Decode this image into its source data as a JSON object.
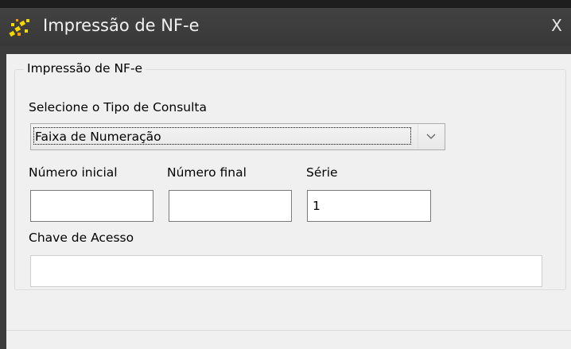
{
  "window": {
    "title": "Impressão de NF-e",
    "close_label": "X"
  },
  "form": {
    "group_title": "Impressão de NF-e",
    "query_type_label": "Selecione o Tipo de Consulta",
    "query_type_selected": "Faixa de Numeração",
    "start_number_label": "Número inicial",
    "start_number_value": "",
    "end_number_label": "Número final",
    "end_number_value": "",
    "series_label": "Série",
    "series_value": "1",
    "access_key_label": "Chave de Acesso",
    "access_key_value": ""
  },
  "icons": {
    "app": "sparkle-icon",
    "dropdown": "chevron-down-icon"
  },
  "colors": {
    "titlebar": "#3c3c3c",
    "client": "#f0f0f0",
    "icon_accent": "#f5d800"
  }
}
